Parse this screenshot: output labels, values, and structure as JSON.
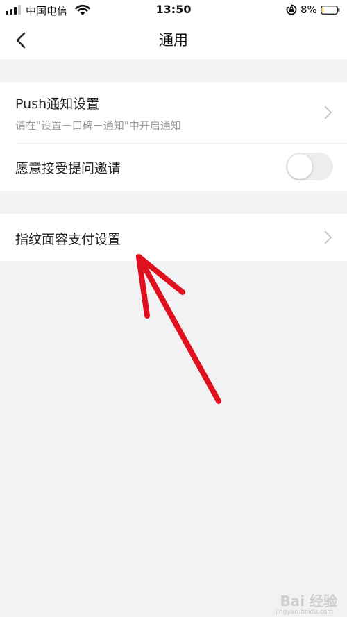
{
  "status_bar": {
    "carrier": "中国电信",
    "time": "13:50",
    "battery_percent": "8%",
    "battery_level": 0.08,
    "icons": [
      "signal-icon",
      "wifi-icon",
      "orientation-lock-icon",
      "battery-icon"
    ]
  },
  "nav": {
    "title": "通用",
    "back_icon": "chevron-left-icon"
  },
  "settings": {
    "push": {
      "title": "Push通知设置",
      "subtitle": "请在\"设置－口碑－通知\"中开启通知"
    },
    "invite": {
      "title": "愿意接受提问邀请",
      "toggle_on": false
    },
    "payment": {
      "title": "指纹面容支付设置"
    }
  },
  "colors": {
    "background": "#f2f2f4",
    "card": "#ffffff",
    "annotation_arrow": "#e0101e",
    "subtitle": "#9a9a9a"
  },
  "watermark": {
    "text": "Bai 经验",
    "url": "jingyan.baidu.com"
  }
}
